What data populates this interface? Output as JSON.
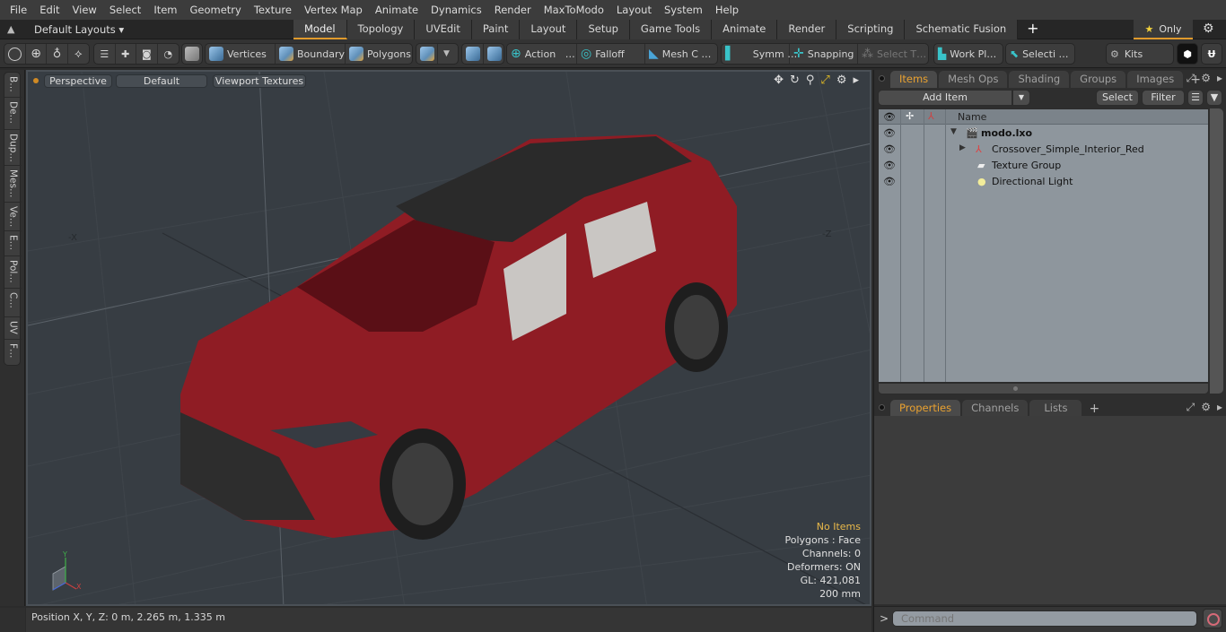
{
  "menu": [
    "File",
    "Edit",
    "View",
    "Select",
    "Item",
    "Geometry",
    "Texture",
    "Vertex Map",
    "Animate",
    "Dynamics",
    "Render",
    "MaxToModo",
    "Layout",
    "System",
    "Help"
  ],
  "layout_bar": {
    "layout_dropdown": "Default Layouts ▾",
    "tabs": [
      "Model",
      "Topology",
      "UVEdit",
      "Paint",
      "Layout",
      "Setup",
      "Game Tools",
      "Animate",
      "Render",
      "Scripting",
      "Schematic Fusion"
    ],
    "active_tab": "Model",
    "only_label": "Only",
    "accent_color": "#e09a2c"
  },
  "toolbar": {
    "vertices": "Vertices",
    "boundary": "Boundary",
    "polygons": "Polygons",
    "action": "Action",
    "action_more": "…",
    "falloff": "Falloff",
    "mesh_c": "Mesh C …",
    "symm": "Symm …",
    "snapping": "Snapping",
    "select_t": "Select T…",
    "work_pl": "Work Pl…",
    "selecti": "Selecti …",
    "kits": "Kits"
  },
  "left_strip": [
    "B…",
    "De…",
    "Dup…",
    "Mes…",
    "Ve…",
    "E…",
    "Pol…",
    "C…",
    "UV",
    "F…"
  ],
  "viewport": {
    "view_mode": "Perspective",
    "shading": "Default",
    "textures": "Viewport Textures",
    "axis_x": "-X",
    "axis_z": "-Z",
    "stats": {
      "selection": "No Items",
      "polygons": "Polygons : Face",
      "channels": "Channels: 0",
      "deformers": "Deformers: ON",
      "gl": "GL: 421,081",
      "grid": "200 mm"
    },
    "gizmo": {
      "x": "X",
      "y": "Y"
    }
  },
  "status": {
    "position": "Position X, Y, Z:   0 m, 2.265 m, 1.335 m"
  },
  "items_panel": {
    "tabs": [
      "Items",
      "Mesh Ops",
      "Shading",
      "Groups",
      "Images"
    ],
    "active_tab": "Items",
    "add_item": "Add Item",
    "select": "Select",
    "filter": "Filter",
    "column_name": "Name",
    "tree": [
      {
        "label": "modo.lxo",
        "type": "scene",
        "expanded": true
      },
      {
        "label": "Crossover_Simple_Interior_Red",
        "type": "mesh",
        "expanded": false
      },
      {
        "label": "Texture Group",
        "type": "texture-group"
      },
      {
        "label": "Directional Light",
        "type": "light"
      }
    ]
  },
  "props_panel": {
    "tabs": [
      "Properties",
      "Channels",
      "Lists"
    ],
    "active_tab": "Properties"
  },
  "command": {
    "prompt": ">",
    "placeholder": "Command"
  }
}
